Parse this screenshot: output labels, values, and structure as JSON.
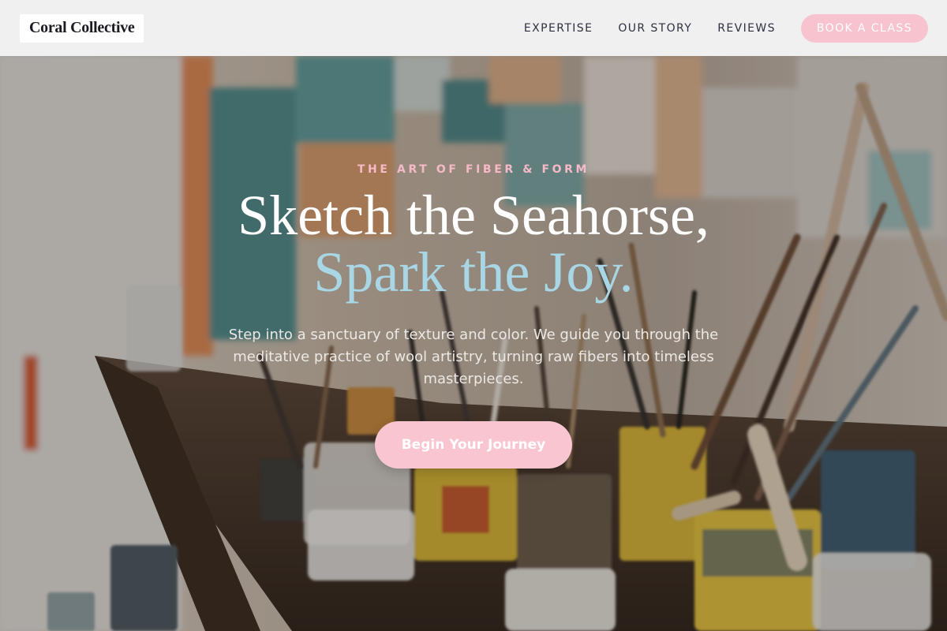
{
  "brand": {
    "name": "Coral Collective"
  },
  "nav": {
    "links": [
      "EXPERTISE",
      "OUR STORY",
      "REVIEWS"
    ],
    "cta": "BOOK A CLASS"
  },
  "hero": {
    "eyebrow": "THE ART OF FIBER & FORM",
    "headline_line1": "Sketch the Seahorse,",
    "headline_line2": "Spark the Joy.",
    "subtitle": "Step into a sanctuary of texture and color. We guide you through the meditative practice of wool artistry, turning raw fibers into timeless masterpieces.",
    "cta": "Begin Your Journey",
    "background_image": "art-studio-paintbrushes-and-paint-cans-photo"
  },
  "colors": {
    "header_bg": "#f0f0f1",
    "pink_accent": "#f9c5d1",
    "blue_accent": "#a9d6e5",
    "nav_text": "#2e3040"
  }
}
